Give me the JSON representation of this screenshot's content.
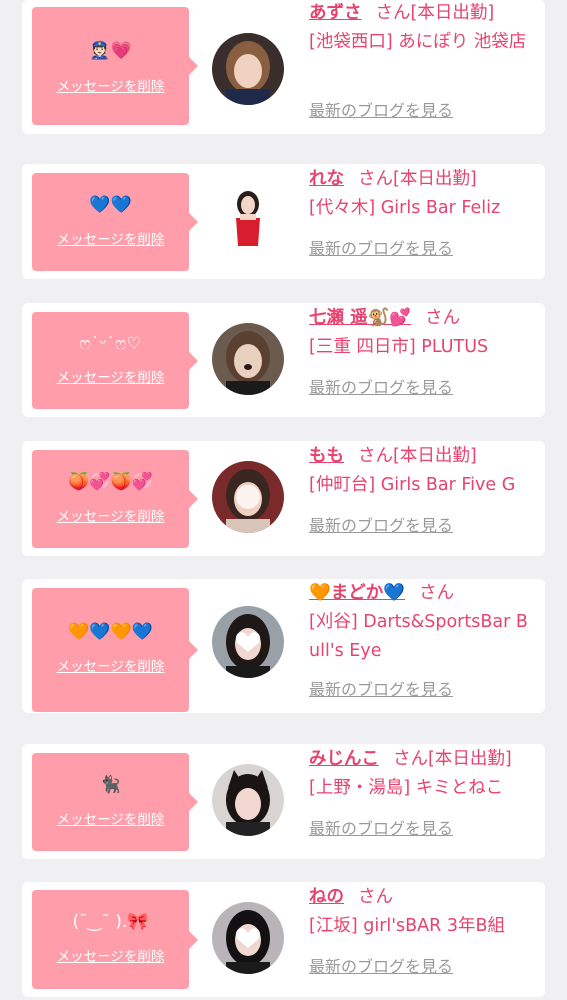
{
  "messages": [
    {
      "emoji": "👮🏻💗",
      "delete_label": "メッセージを削除",
      "name": "あずさ",
      "honorific": "さん",
      "status": "[本日出勤]",
      "shop": "[池袋西口] あにぽり 池袋店",
      "blog_label": "最新のブログを見る",
      "avatar": {
        "bg": "#3a2e2c",
        "face": "#f1d2c2",
        "hair": "#8a5e40",
        "style": "photo"
      }
    },
    {
      "emoji": "💙💙",
      "delete_label": "メッセージを削除",
      "name": "れな",
      "honorific": "さん",
      "status": "[本日出勤]",
      "shop": "[代々木] Girls Bar Feliz",
      "blog_label": "最新のブログを見る",
      "avatar": {
        "bg": "#ffffff",
        "face": "#f3d6c8",
        "hair": "#2a1e1c",
        "style": "fullbody-red"
      }
    },
    {
      "emoji": "ෆ˙ᵕ˙ෆ♡",
      "delete_label": "メッセージを削除",
      "name": "七瀬 遥🐒💕",
      "honorific": "さん",
      "status": "",
      "shop": "[三重 四日市] PLUTUS",
      "blog_label": "最新のブログを見る",
      "avatar": {
        "bg": "#6b5a4e",
        "face": "#ead0bf",
        "hair": "#5a4030",
        "style": "photo"
      }
    },
    {
      "emoji": "🍑💞🍑💞",
      "delete_label": "メッセージを削除",
      "name": "もも",
      "honorific": "さん",
      "status": "[本日出勤]",
      "shop": "[仲町台] Girls Bar Five G",
      "blog_label": "最新のブログを見る",
      "avatar": {
        "bg": "#7a2a2a",
        "face": "#f0d0c0",
        "hair": "#3a2620",
        "style": "blurred"
      }
    },
    {
      "emoji": "🧡💙🧡💙",
      "delete_label": "メッセージを削除",
      "name": "🧡まどか💙",
      "honorific": "さん",
      "status": "",
      "shop": "[刈谷] Darts&SportsBar Bull's Eye",
      "blog_label": "最新のブログを見る",
      "avatar": {
        "bg": "#9aa0a8",
        "face": "#ffffff",
        "hair": "#1e1816",
        "style": "heart-face"
      }
    },
    {
      "emoji": "🐈‍⬛",
      "delete_label": "メッセージを削除",
      "name": "みじんこ",
      "honorific": "さん",
      "status": "[本日出勤]",
      "shop": "[上野・湯島] キミとねこ",
      "blog_label": "最新のブログを見る",
      "avatar": {
        "bg": "#d8d4d2",
        "face": "#f0d8d0",
        "hair": "#1a1412",
        "style": "cat-ears"
      }
    },
    {
      "emoji": "(¯‿¯ ).🎀",
      "delete_label": "メッセージを削除",
      "name": "ねの",
      "honorific": "さん",
      "status": "",
      "shop": "[江坂] girl'sBAR 3年B組",
      "blog_label": "最新のブログを見る",
      "avatar": {
        "bg": "#b8b4b8",
        "face": "#ffffff",
        "hair": "#141012",
        "style": "heart-face"
      }
    }
  ]
}
